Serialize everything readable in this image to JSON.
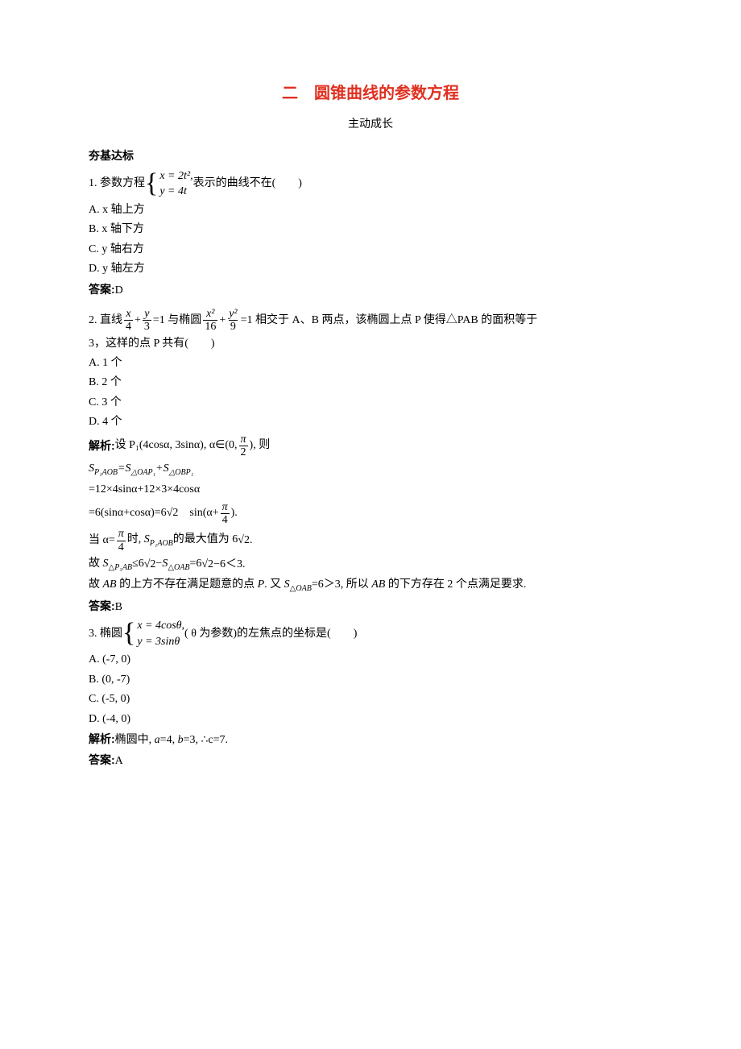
{
  "title": "二　圆锥曲线的参数方程",
  "subtitle": "主动成长",
  "section_head": "夯基达标",
  "q1": {
    "stem_lead": "1. 参数方程",
    "sys_line1": "x = 2t²,",
    "sys_line2": "y = 4t",
    "stem_tail": " 表示的曲线不在(　　)",
    "optA": "A. x 轴上方",
    "optB": "B. x 轴下方",
    "optC": "C. y 轴右方",
    "optD": "D. y 轴左方",
    "ans_label": "答案:",
    "ans": "D"
  },
  "q2": {
    "stem_lead": "2. 直线",
    "frac1_num": "x",
    "frac1_den": "4",
    "plus1": "+",
    "frac2_num": "y",
    "frac2_den": "3",
    "eq1": "=1 与椭圆",
    "frac3_num": "x²",
    "frac3_den": "16",
    "plus2": "+",
    "frac4_num": "y²",
    "frac4_den": "9",
    "eq2": "=1 相交于 A、B 两点，该椭圆上点 P 使得△PAB 的面积等于",
    "line2": "3，这样的点 P 共有(　　)",
    "optA": "A. 1 个",
    "optB": "B. 2 个",
    "optC": "C. 3 个",
    "optD": "D. 4 个",
    "sol_label": "解析:",
    "sol_l1_a": "设 P₁(4cosα, 3sinα), α∈(0, ",
    "sol_pi2_num": "π",
    "sol_pi2_den": "2",
    "sol_l1_b": "), 则",
    "sol_l2": "S_{P₁AOB}=S_{△OAP₁}+S_{△OBP₁}",
    "sol_l3": "=12×4sinα+12×3×4cosα",
    "sol_l4_a": "=6(sinα+cosα)=6",
    "sol_l4_sqrt": "√2",
    "sol_l4_b": "　sin(α+",
    "sol_pi4_num": "π",
    "sol_pi4_den": "4",
    "sol_l4_c": ").",
    "sol_l5_a": "当 α=",
    "sol_l5_b": "时, S_{P₁AOB}的最大值为 6",
    "sol_l5_sqrt": "√2",
    "sol_l5_c": " .",
    "sol_l6_a": "故 S_{△P₁AB}≤6",
    "sol_l6_sqrt1": "√2",
    "sol_l6_b": " −S_{△OAB}=6",
    "sol_l6_sqrt2": "√2",
    "sol_l6_c": " −6＜3.",
    "sol_l7": "故 AB 的上方不存在满足题意的点 P. 又 S_{△OAB}=6＞3, 所以 AB 的下方存在 2 个点满足要求.",
    "ans_label": "答案:",
    "ans": "B"
  },
  "q3": {
    "stem_lead": "3. 椭圆",
    "sys_line1": "x = 4cosθ,",
    "sys_line2": "y = 3sinθ",
    "stem_tail": "( θ 为参数)的左焦点的坐标是(　　)",
    "optA": "A. (-7, 0)",
    "optB": "B. (0, -7)",
    "optC": "C. (-5, 0)",
    "optD": "D. (-4, 0)",
    "sol_label": "解析:",
    "sol": "椭圆中, a=4, b=3, ∴c=7.",
    "ans_label": "答案:",
    "ans": "A"
  }
}
